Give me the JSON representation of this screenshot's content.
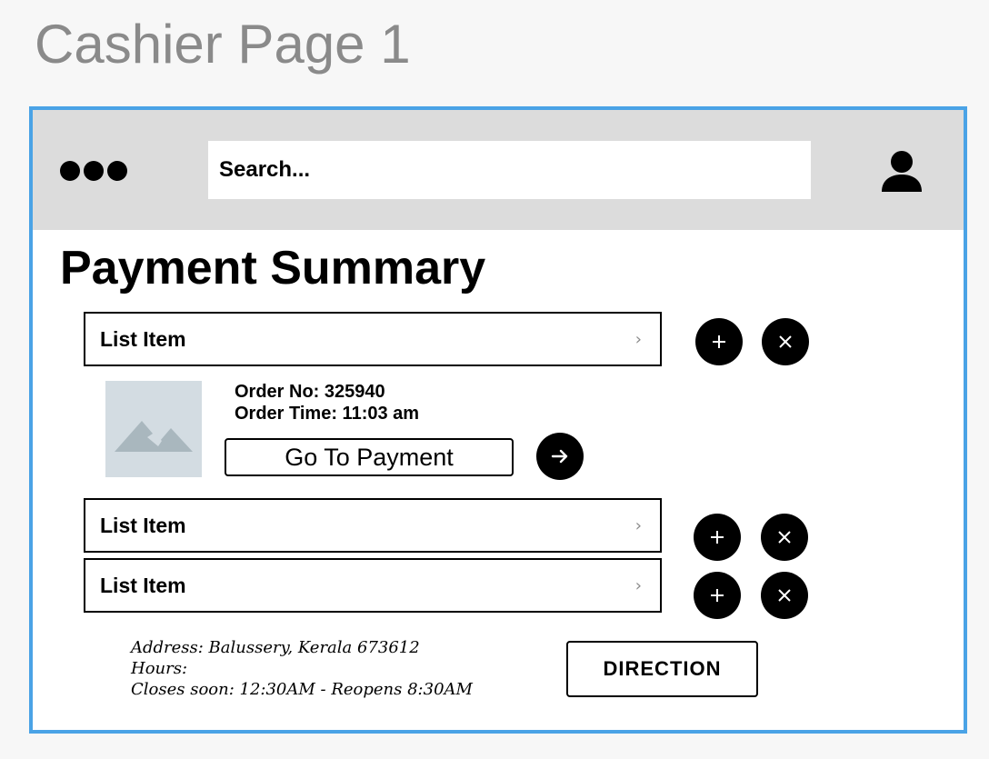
{
  "page": {
    "title": "Cashier Page 1"
  },
  "header": {
    "menu_icon": "more-dots-icon",
    "search_placeholder": "Search...",
    "user_icon": "user-icon"
  },
  "main": {
    "heading": "Payment Summary",
    "list_items": [
      {
        "label": "List Item",
        "chevron": "›"
      },
      {
        "label": "List Item",
        "chevron": "›"
      },
      {
        "label": "List Item",
        "chevron": "›"
      }
    ],
    "order": {
      "order_no": "Order No: 325940",
      "order_time": "Order Time: 11:03 am",
      "payment_button": "Go To Payment",
      "image_icon": "image-placeholder-icon",
      "arrow_icon": "arrow-right-icon"
    }
  },
  "footer": {
    "address_line": "Address: Balussery, Kerala 673612",
    "hours_label": "Hours:",
    "hours_line": "Closes soon: 12:30AM - Reopens 8:30AM",
    "direction_button": "DIRECTION"
  },
  "colors": {
    "frame_border": "#4aa3e6",
    "header_bg": "#dcdcdc",
    "page_title": "#8a8a8a",
    "placeholder_image_bg": "#d3dce2"
  }
}
